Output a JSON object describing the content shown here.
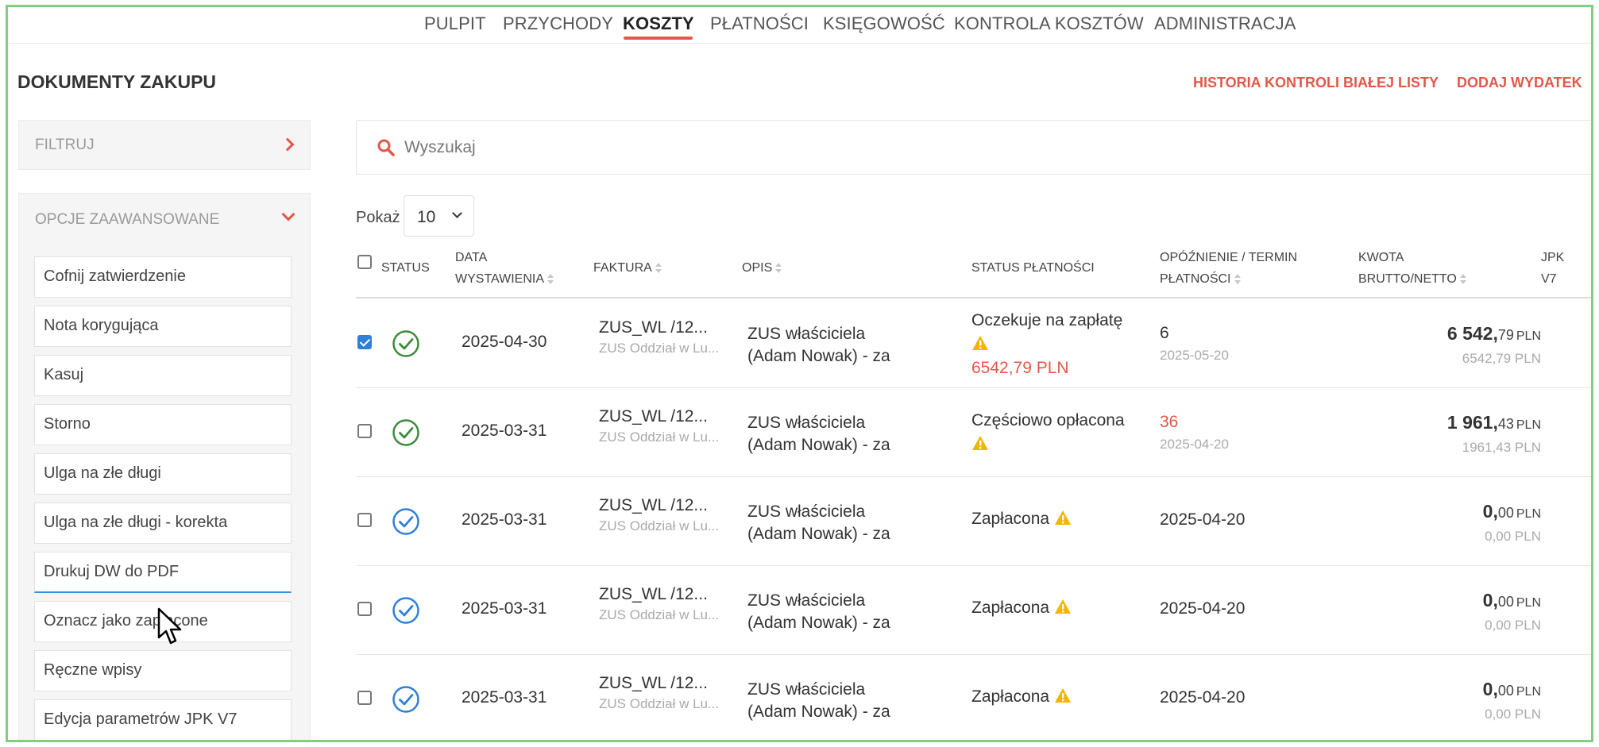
{
  "nav": {
    "items": [
      "PULPIT",
      "PRZYCHODY",
      "KOSZTY",
      "PŁATNOŚCI",
      "KSIĘGOWOŚĆ",
      "KONTROLA KOSZTÓW",
      "ADMINISTRACJA"
    ],
    "active": "KOSZTY"
  },
  "page": {
    "title": "DOKUMENTY ZAKUPU",
    "history_link": "HISTORIA KONTROLI BIAŁEJ LISTY",
    "add_link": "DODAJ WYDATEK"
  },
  "sidebar": {
    "filter_label": "FILTRUJ",
    "advanced_label": "OPCJE ZAAWANSOWANE",
    "options": [
      "Cofnij zatwierdzenie",
      "Nota korygująca",
      "Kasuj",
      "Storno",
      "Ulga na złe długi",
      "Ulga na złe długi - korekta",
      "Drukuj DW do PDF",
      "Oznacz jako zapłacone",
      "Ręczne wpisy",
      "Edycja parametrów JPK V7"
    ]
  },
  "search": {
    "placeholder": "Wyszukaj",
    "value": ""
  },
  "pager": {
    "label": "Pokaż",
    "selected": "10"
  },
  "table": {
    "headers": {
      "status": "STATUS",
      "date_1": "DATA",
      "date_2": "WYSTAWIENIA",
      "invoice": "FAKTURA",
      "desc": "OPIS",
      "payment_status": "STATUS PŁATNOŚCI",
      "delay_1": "OPÓŹNIENIE / TERMIN",
      "delay_2": "PŁATNOŚCI",
      "amount_1": "KWOTA",
      "amount_2": "BRUTTO/NETTO",
      "jpk_1": "JPK",
      "jpk_2": "V7"
    },
    "rows": [
      {
        "checked": true,
        "status_icon": "check-circle-green-icon",
        "date": "2025-04-30",
        "invoice": "ZUS_WL /12...",
        "invoice_sub": "ZUS Oddział w Lu...",
        "desc_1": "ZUS właściciela",
        "desc_2": "(Adam Nowak) - za",
        "payment_status": "Oczekuje na zapłatę",
        "payment_extra": "6542,79 PLN",
        "delay": "6",
        "due": "2025-05-20",
        "amount_int": "6 542,",
        "amount_dec": "79",
        "currency": "PLN",
        "amount_net": "6542,79 PLN"
      },
      {
        "checked": false,
        "status_icon": "check-circle-green-icon",
        "date": "2025-03-31",
        "invoice": "ZUS_WL /12...",
        "invoice_sub": "ZUS Oddział w Lu...",
        "desc_1": "ZUS właściciela",
        "desc_2": "(Adam Nowak) - za",
        "payment_status": "Częściowo opłacona",
        "payment_extra": "",
        "delay": "36",
        "due": "2025-04-20",
        "amount_int": "1 961,",
        "amount_dec": "43",
        "currency": "PLN",
        "amount_net": "1961,43 PLN"
      },
      {
        "checked": false,
        "status_icon": "check-circle-blue-icon",
        "date": "2025-03-31",
        "invoice": "ZUS_WL /12...",
        "invoice_sub": "ZUS Oddział w Lu...",
        "desc_1": "ZUS właściciela",
        "desc_2": "(Adam Nowak) - za",
        "payment_status": "Zapłacona",
        "payment_extra": "",
        "delay": "",
        "due": "2025-04-20",
        "amount_int": "0,",
        "amount_dec": "00",
        "currency": "PLN",
        "amount_net": "0,00 PLN"
      },
      {
        "checked": false,
        "status_icon": "check-circle-blue-icon",
        "date": "2025-03-31",
        "invoice": "ZUS_WL /12...",
        "invoice_sub": "ZUS Oddział w Lu...",
        "desc_1": "ZUS właściciela",
        "desc_2": "(Adam Nowak) - za",
        "payment_status": "Zapłacona",
        "payment_extra": "",
        "delay": "",
        "due": "2025-04-20",
        "amount_int": "0,",
        "amount_dec": "00",
        "currency": "PLN",
        "amount_net": "0,00 PLN"
      },
      {
        "checked": false,
        "status_icon": "check-circle-blue-icon",
        "date": "2025-03-31",
        "invoice": "ZUS_WL /12...",
        "invoice_sub": "ZUS Oddział w Lu...",
        "desc_1": "ZUS właściciela",
        "desc_2": "(Adam Nowak) - za",
        "payment_status": "Zapłacona",
        "payment_extra": "",
        "delay": "",
        "due": "2025-04-20",
        "amount_int": "0,",
        "amount_dec": "00",
        "currency": "PLN",
        "amount_net": "0,00 PLN"
      }
    ]
  },
  "colors": {
    "accent": "#e2584a",
    "frame": "#7fcf7f",
    "status_green": "#3c8a3c",
    "status_blue": "#2f7fd8",
    "warning": "#f5b400"
  }
}
